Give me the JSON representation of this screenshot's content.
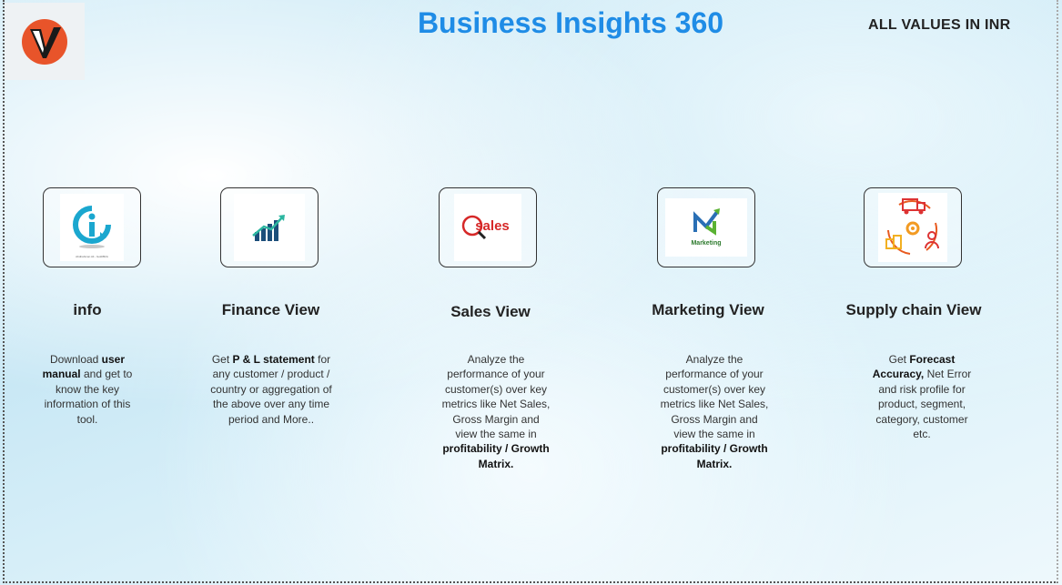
{
  "header": {
    "title": "Business Insights 360",
    "currency_note": "ALL VALUES IN INR"
  },
  "logo": {
    "icon": "brand-v-logo-icon"
  },
  "colors": {
    "title": "#1f8ce6",
    "logo_orange": "#e8542a",
    "sales_red": "#d62828",
    "marketing_blue": "#2a6fb5",
    "marketing_green": "#5ab233"
  },
  "nav": [
    {
      "id": "info",
      "label": "info",
      "icon": "info-icon",
      "image_caption": "Abdirahman Ali - Gold/B2A",
      "desc_parts": [
        {
          "t": "Download "
        },
        {
          "t": "user manual",
          "b": true
        },
        {
          "t": " and get to know the key information of this tool."
        }
      ]
    },
    {
      "id": "finance",
      "label": "Finance View",
      "icon": "bar-chart-growth-icon",
      "desc_parts": [
        {
          "t": "Get  "
        },
        {
          "t": "P & L statement",
          "b": true
        },
        {
          "t": " for any customer / product / country or aggregation of the above over any time period and More.."
        }
      ]
    },
    {
      "id": "sales",
      "label": "Sales View",
      "icon": "sales-magnifier-icon",
      "image_text": "sales",
      "desc_parts": [
        {
          "t": "Analyze the performance of your customer(s) over key metrics like Net Sales, Gross Margin and view the same in "
        },
        {
          "t": "profitability / Growth Matrix.",
          "b": true
        }
      ]
    },
    {
      "id": "marketing",
      "label": "Marketing View",
      "icon": "marketing-m-icon",
      "image_text": "Marketing",
      "desc_parts": [
        {
          "t": "Analyze the performance of your customer(s) over key metrics like Net Sales, Gross Margin and view the same in "
        },
        {
          "t": "profitability / Growth Matrix.",
          "b": true
        }
      ]
    },
    {
      "id": "supply",
      "label": "Supply chain View",
      "icon": "supply-chain-cycle-icon",
      "desc_parts": [
        {
          "t": "Get "
        },
        {
          "t": "Forecast Accuracy,",
          "b": true
        },
        {
          "t": " Net Error and risk profile for product, segment, category, customer etc."
        }
      ]
    }
  ]
}
